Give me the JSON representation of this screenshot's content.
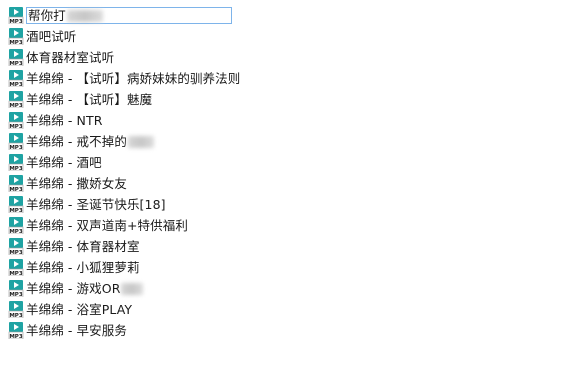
{
  "files": [
    {
      "name": "帮你打",
      "icon": "mp3-file-icon",
      "selected": true,
      "redacted": true
    },
    {
      "name": "酒吧试听",
      "icon": "mp3-file-icon"
    },
    {
      "name": "体育器材室试听",
      "icon": "mp3-file-icon"
    },
    {
      "name": "羊绵绵 - 【试听】病娇妹妹的驯养法则",
      "icon": "mp3-file-icon"
    },
    {
      "name": "羊绵绵 - 【试听】魅魔",
      "icon": "mp3-file-icon"
    },
    {
      "name": "羊绵绵 - NTR",
      "icon": "mp3-file-icon"
    },
    {
      "name": "羊绵绵 - 戒不掉的",
      "icon": "mp3-file-icon",
      "redacted": true
    },
    {
      "name": "羊绵绵 - 酒吧",
      "icon": "mp3-file-icon"
    },
    {
      "name": "羊绵绵 - 撒娇女友",
      "icon": "mp3-file-icon"
    },
    {
      "name": "羊绵绵 - 圣诞节快乐[18]",
      "icon": "mp3-file-icon"
    },
    {
      "name": "羊绵绵 - 双声道南+特供福利",
      "icon": "mp3-file-icon"
    },
    {
      "name": "羊绵绵 - 体育器材室",
      "icon": "mp3-file-icon"
    },
    {
      "name": "羊绵绵 - 小狐狸萝莉",
      "icon": "mp3-file-icon"
    },
    {
      "name": "羊绵绵 - 游戏OR",
      "icon": "mp3-file-icon",
      "redacted": true
    },
    {
      "name": "羊绵绵 - 浴室PLAY",
      "icon": "mp3-file-icon"
    },
    {
      "name": "羊绵绵 - 早安服务",
      "icon": "mp3-file-icon"
    }
  ],
  "icon_label": "MP3",
  "colors": {
    "icon_top": "#1fa3a3",
    "icon_play": "#ffffff",
    "icon_label": "#1a1a1a",
    "selection_border": "#7eb4ea"
  }
}
